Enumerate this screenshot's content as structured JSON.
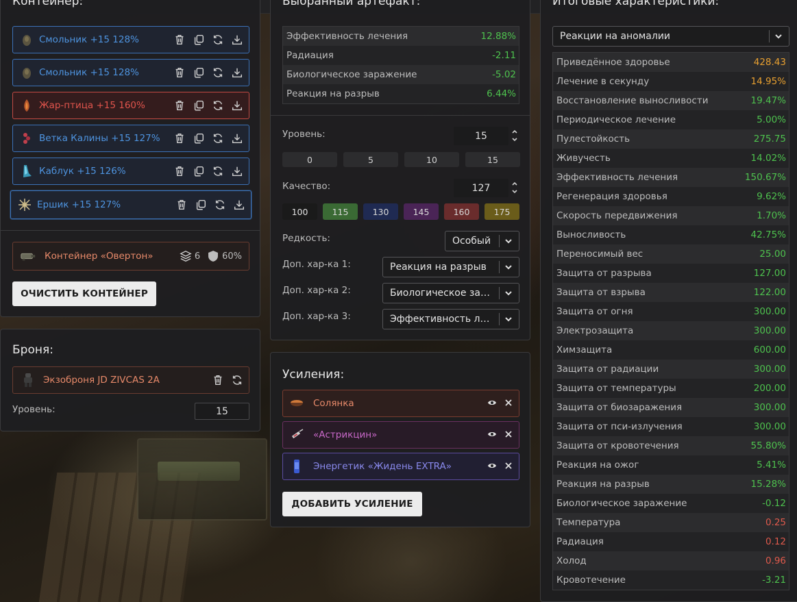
{
  "container": {
    "title": "Контейнер:",
    "artifacts": [
      {
        "name": "Смольник +15 128%",
        "color": "blue",
        "icon": "smolnik-icon"
      },
      {
        "name": "Смольник +15 128%",
        "color": "blue",
        "icon": "smolnik-icon"
      },
      {
        "name": "Жар-птица +15 160%",
        "color": "red",
        "icon": "zhar-ptitsa-icon"
      },
      {
        "name": "Ветка Калины +15 127%",
        "color": "blue",
        "icon": "vetka-kaliny-icon"
      },
      {
        "name": "Каблук +15 126%",
        "color": "blue",
        "icon": "kabluk-icon"
      },
      {
        "name": "Ершик +15 127%",
        "color": "blue",
        "icon": "ershik-icon"
      }
    ],
    "container_item": {
      "name": "Контейнер «Овертон»",
      "slots": "6",
      "protection": "60%"
    },
    "clear_label": "ОЧИСТИТЬ КОНТЕЙНЕР"
  },
  "armor": {
    "title": "Броня:",
    "name": "Экзоброня JD ZIVCAS 2A",
    "level_label": "Уровень:",
    "level_value": "15"
  },
  "artifact": {
    "title": "Выбранный артефакт:",
    "stats": [
      {
        "name": "Эффективность лечения",
        "value": "12.88%",
        "tone": "green"
      },
      {
        "name": "Радиация",
        "value": "-2.11",
        "tone": "green"
      },
      {
        "name": "Биологическое заражение",
        "value": "-5.02",
        "tone": "green"
      },
      {
        "name": "Реакция на разрыв",
        "value": "6.44%",
        "tone": "green"
      }
    ],
    "level_label": "Уровень:",
    "level_value": "15",
    "level_presets": [
      "0",
      "5",
      "10",
      "15"
    ],
    "quality_label": "Качество:",
    "quality_value": "127",
    "quality_presets": [
      {
        "label": "100",
        "bg": "#1a1a1a",
        "fg": "#e0e0e0"
      },
      {
        "label": "115",
        "bg": "#3a6a34",
        "fg": "#d8d8d8"
      },
      {
        "label": "130",
        "bg": "#1f2a52",
        "fg": "#d8d8d8"
      },
      {
        "label": "145",
        "bg": "#4a2456",
        "fg": "#d8d8d8"
      },
      {
        "label": "160",
        "bg": "#6a2c2c",
        "fg": "#d8d8d8"
      },
      {
        "label": "175",
        "bg": "#6a5c1a",
        "fg": "#d8d8d8"
      }
    ],
    "rarity_label": "Редкость:",
    "rarity_value": "Особый",
    "extra1_label": "Доп. хар-ка 1:",
    "extra1_value": "Реакция на разрыв",
    "extra2_label": "Доп. хар-ка 2:",
    "extra2_value": "Биологическое заражение",
    "extra3_label": "Доп. хар-ка 3:",
    "extra3_value": "Эффективность лечения"
  },
  "boosts": {
    "title": "Усиления:",
    "items": [
      {
        "name": "Солянка",
        "fg": "#e88a6a",
        "border": "#7a3c30",
        "bg": "rgba(60,32,28,0.55)",
        "icon": "solyanka-icon"
      },
      {
        "name": "«Астрикцин»",
        "fg": "#c868c8",
        "border": "#6a3060",
        "bg": "rgba(50,26,46,0.55)",
        "icon": "syringe-icon"
      },
      {
        "name": "Энергетик «Жидень EXTRA»",
        "fg": "#8a8aee",
        "border": "#5c4ca0",
        "bg": "rgba(36,32,66,0.55)",
        "icon": "energy-drink-icon"
      }
    ],
    "add_label": "ДОБАВИТЬ УСИЛЕНИЕ"
  },
  "totals": {
    "title": "Итоговые характеристики:",
    "filter_value": "Реакции на аномалии",
    "stats": [
      {
        "name": "Приведённое здоровье",
        "value": "428.43",
        "tone": "orange"
      },
      {
        "name": "Лечение в секунду",
        "value": "14.95%",
        "tone": "orange"
      },
      {
        "name": "Восстановление выносливости",
        "value": "19.47%",
        "tone": "green"
      },
      {
        "name": "Периодическое лечение",
        "value": "5.00%",
        "tone": "green"
      },
      {
        "name": "Пулестойкость",
        "value": "275.75",
        "tone": "green"
      },
      {
        "name": "Живучесть",
        "value": "14.02%",
        "tone": "green"
      },
      {
        "name": "Эффективность лечения",
        "value": "150.67%",
        "tone": "green"
      },
      {
        "name": "Регенерация здоровья",
        "value": "9.62%",
        "tone": "green"
      },
      {
        "name": "Скорость передвижения",
        "value": "1.70%",
        "tone": "green"
      },
      {
        "name": "Выносливость",
        "value": "42.75%",
        "tone": "green"
      },
      {
        "name": "Переносимый вес",
        "value": "25.00",
        "tone": "green"
      },
      {
        "name": "Защита от разрыва",
        "value": "127.00",
        "tone": "green"
      },
      {
        "name": "Защита от взрыва",
        "value": "122.00",
        "tone": "green"
      },
      {
        "name": "Защита от огня",
        "value": "300.00",
        "tone": "green"
      },
      {
        "name": "Электрозащита",
        "value": "300.00",
        "tone": "green"
      },
      {
        "name": "Химзащита",
        "value": "600.00",
        "tone": "green"
      },
      {
        "name": "Защита от радиации",
        "value": "300.00",
        "tone": "green"
      },
      {
        "name": "Защита от температуры",
        "value": "200.00",
        "tone": "green"
      },
      {
        "name": "Защита от биозаражения",
        "value": "300.00",
        "tone": "green"
      },
      {
        "name": "Защита от пси-излучения",
        "value": "300.00",
        "tone": "green"
      },
      {
        "name": "Защита от кровотечения",
        "value": "55.80%",
        "tone": "green"
      },
      {
        "name": "Реакция на ожог",
        "value": "5.41%",
        "tone": "green"
      },
      {
        "name": "Реакция на разрыв",
        "value": "15.28%",
        "tone": "green"
      },
      {
        "name": "Биологическое заражение",
        "value": "-0.12",
        "tone": "green"
      },
      {
        "name": "Температура",
        "value": "0.25",
        "tone": "red"
      },
      {
        "name": "Радиация",
        "value": "0.12",
        "tone": "red"
      },
      {
        "name": "Холод",
        "value": "0.96",
        "tone": "red"
      },
      {
        "name": "Кровотечение",
        "value": "-3.21",
        "tone": "green"
      }
    ]
  }
}
